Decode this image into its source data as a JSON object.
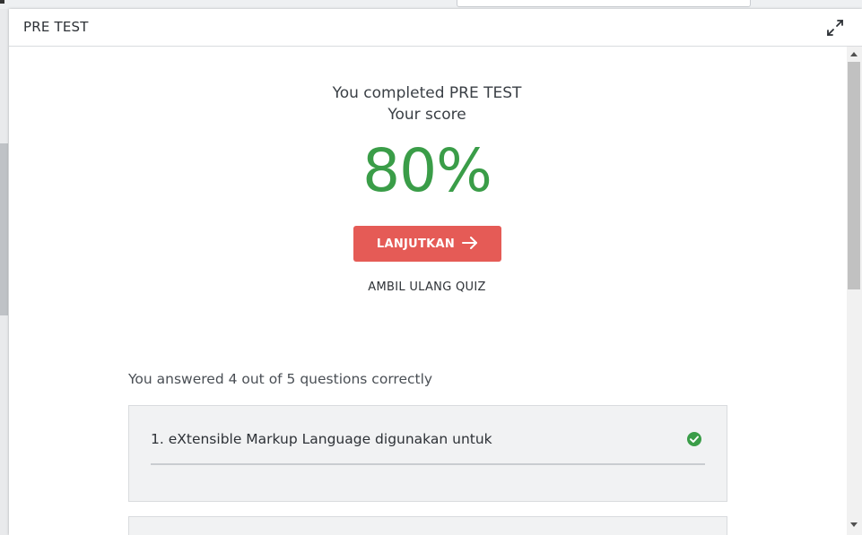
{
  "modal": {
    "title": "PRE TEST",
    "expand_icon": "expand-icon"
  },
  "result": {
    "completed_text": "You completed PRE TEST",
    "score_label": "Your score",
    "score_value": "80%",
    "score_color": "#3a9d48"
  },
  "actions": {
    "continue_label": "LANJUTKAN",
    "continue_icon": "arrow-right-icon",
    "continue_color": "#e55b56",
    "retake_label": "AMBIL ULANG QUIZ"
  },
  "summary": {
    "text": "You answered 4 out of 5 questions correctly"
  },
  "questions": [
    {
      "text": "1. eXtensible Markup Language digunakan untuk",
      "correct": true,
      "status_icon": "check-circle-icon"
    }
  ]
}
